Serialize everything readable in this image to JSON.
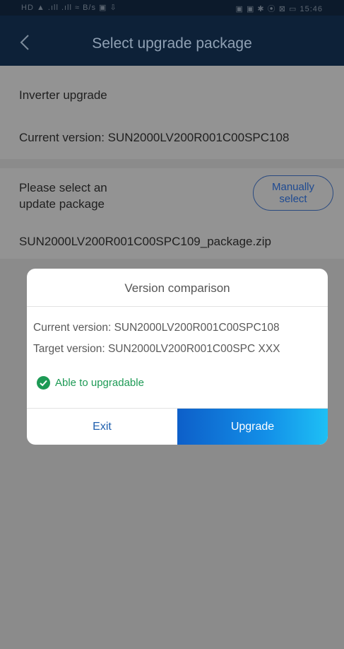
{
  "status_bar": {
    "left": "HD ▲ .ıll .ıll ≈ B/s ▣ ⇩",
    "right": "▣ ▣ ✱ ⦿ ⊠ ▭ 15:46"
  },
  "header": {
    "title": "Select upgrade package"
  },
  "inverter": {
    "title": "Inverter upgrade",
    "current_version": "Current version: SUN2000LV200R001C00SPC108"
  },
  "package": {
    "prompt_line1": "Please select an",
    "prompt_line2": "update package",
    "manual_line1": "Manually",
    "manual_line2": "select",
    "selected_file": "SUN2000LV200R001C00SPC109_package.zip"
  },
  "dialog": {
    "title": "Version comparison",
    "current": "Current version: SUN2000LV200R001C00SPC108",
    "target": "Target version:  SUN2000LV200R001C00SPC XXX",
    "status": "Able to upgradable",
    "exit_label": "Exit",
    "upgrade_label": "Upgrade"
  },
  "colors": {
    "header_bg": "#0d2138",
    "overlay_bg": "#8b8b8b",
    "success": "#1d9a55",
    "accent": "#1390e8"
  },
  "icons": [
    "back-icon",
    "check-circle-icon"
  ]
}
